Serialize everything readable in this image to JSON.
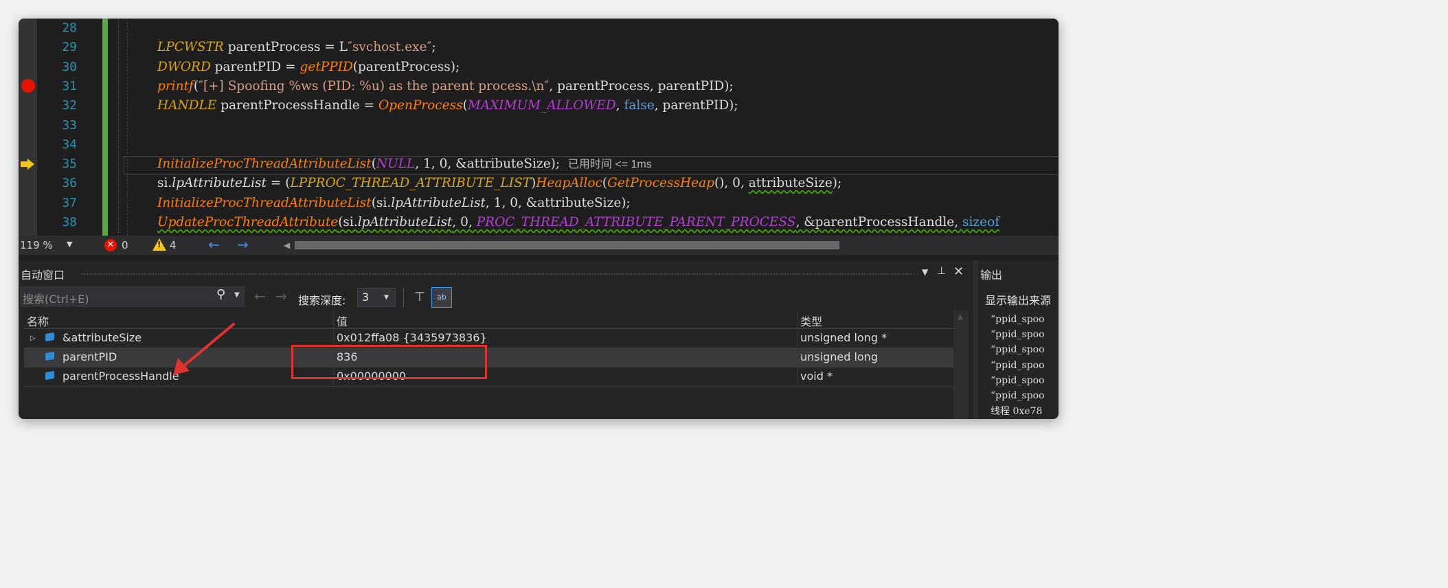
{
  "editor": {
    "lines": [
      {
        "num": "28"
      },
      {
        "num": "29",
        "parts": [
          {
            "t": "LPCWSTR",
            "c": "t-type"
          },
          {
            "t": " parentProcess = L"
          },
          {
            "t": "″svchost.exe″",
            "c": "t-str"
          },
          {
            "t": ";"
          }
        ]
      },
      {
        "num": "30",
        "parts": [
          {
            "t": "DWORD",
            "c": "t-type"
          },
          {
            "t": " parentPID = "
          },
          {
            "t": "getPPID",
            "c": "t-fn"
          },
          {
            "t": "(parentProcess);"
          }
        ]
      },
      {
        "num": "31",
        "breakpoint": true,
        "parts": [
          {
            "t": "printf",
            "c": "t-fn"
          },
          {
            "t": "("
          },
          {
            "t": "″[+] Spoofing %ws (PID: %u) as the parent process.\\n″",
            "c": "t-str"
          },
          {
            "t": ", parentProcess, parentPID);"
          }
        ]
      },
      {
        "num": "32",
        "parts": [
          {
            "t": "HANDLE",
            "c": "t-type"
          },
          {
            "t": " parentProcessHandle = "
          },
          {
            "t": "OpenProcess",
            "c": "t-fn"
          },
          {
            "t": "("
          },
          {
            "t": "MAXIMUM_ALLOWED",
            "c": "t-mac"
          },
          {
            "t": ", "
          },
          {
            "t": "false",
            "c": "t-kw"
          },
          {
            "t": ", parentPID);"
          }
        ]
      },
      {
        "num": "33"
      },
      {
        "num": "34"
      },
      {
        "num": "35",
        "current": true,
        "parts": [
          {
            "t": "InitializeProcThreadAttributeList",
            "c": "t-fn"
          },
          {
            "t": "("
          },
          {
            "t": "NULL",
            "c": "t-mac"
          },
          {
            "t": ", 1, 0, &attributeSize);  "
          },
          {
            "t": "已用时间 ",
            "c": "perf"
          },
          {
            "t": "<= 1ms",
            "c": "perf"
          }
        ]
      },
      {
        "num": "36",
        "parts": [
          {
            "t": "si."
          },
          {
            "t": "lpAttributeList",
            "c": "t-mem"
          },
          {
            "t": " = ("
          },
          {
            "t": "LPPROC_THREAD_ATTRIBUTE_LIST",
            "c": "t-type"
          },
          {
            "t": ")"
          },
          {
            "t": "HeapAlloc",
            "c": "t-fn"
          },
          {
            "t": "("
          },
          {
            "t": "GetProcessHeap",
            "c": "t-fn"
          },
          {
            "t": "(), 0, "
          },
          {
            "t": "attributeSize",
            "c": "t-sq"
          },
          {
            "t": ");"
          }
        ]
      },
      {
        "num": "37",
        "parts": [
          {
            "t": "InitializeProcThreadAttributeList",
            "c": "t-fn"
          },
          {
            "t": "(si."
          },
          {
            "t": "lpAttributeList",
            "c": "t-mem"
          },
          {
            "t": ", 1, 0, &attributeSize);"
          }
        ]
      },
      {
        "num": "38",
        "parts": [
          {
            "t": "UpdateProcThreadAttribute",
            "c": "t-fn t-sq"
          },
          {
            "t": "(si.",
            "c": "t-sq"
          },
          {
            "t": "lpAttributeList",
            "c": "t-mem t-sq"
          },
          {
            "t": ", 0, ",
            "c": "t-sq"
          },
          {
            "t": "PROC_THREAD_ATTRIBUTE_PARENT_PROCESS",
            "c": "t-mac t-sq"
          },
          {
            "t": ", &parentProcessHandle, ",
            "c": "t-sq"
          },
          {
            "t": "sizeof",
            "c": "t-kw t-sq"
          }
        ]
      }
    ]
  },
  "status": {
    "zoom": "119 %",
    "errors": "0",
    "warnings": "4"
  },
  "autos": {
    "title": "自动窗口",
    "search_placeholder": "搜索(Ctrl+E)",
    "depth_label": "搜索深度:",
    "depth_value": "3",
    "columns": {
      "name": "名称",
      "value": "值",
      "type": "类型"
    },
    "rows": [
      {
        "name": "&attributeSize",
        "value": "0x012ffa08 {3435973836}",
        "type": "unsigned long *",
        "expandable": true
      },
      {
        "name": "parentPID",
        "value": "836",
        "type": "unsigned long"
      },
      {
        "name": "parentProcessHandle",
        "value": "0x00000000",
        "type": "void *"
      }
    ]
  },
  "output": {
    "title": "输出",
    "source_label": "显示输出来源",
    "lines": [
      "“ppid_spoo",
      "“ppid_spoo",
      "“ppid_spoo",
      "“ppid_spoo",
      "“ppid_spoo",
      "“ppid_spoo"
    ],
    "thread": "线程 0xe78"
  },
  "colors": {
    "breakpoint": "#e51400",
    "instruction_pointer": "#f5c518",
    "annotation": "#e0322d",
    "selection_accent": "#3399ff"
  },
  "icons": [
    "breakpoint-icon",
    "instruction-pointer-icon",
    "error-icon",
    "warning-icon",
    "search-icon",
    "filter-icon",
    "hex-display-icon",
    "pin-icon",
    "close-icon"
  ]
}
